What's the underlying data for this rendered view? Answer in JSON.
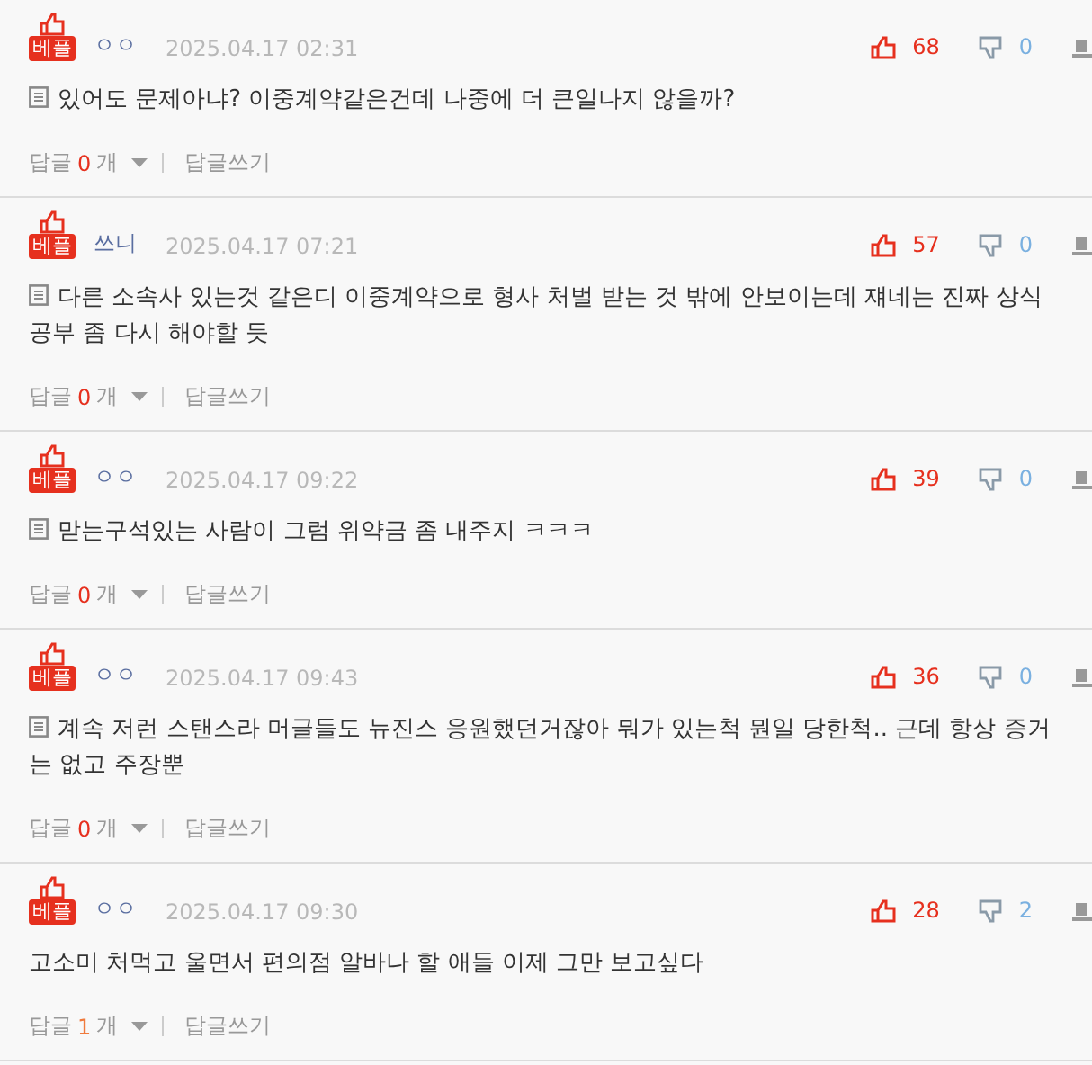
{
  "comments": [
    {
      "badge": "베플",
      "author": "ㅇㅇ",
      "date": "2025.04.17 02:31",
      "likes": "68",
      "dislikes": "0",
      "kind": "memo",
      "text": "있어도 문제아냐? 이중계약같은건데 나중에 더 큰일나지 않을까?",
      "reply_label": "답글",
      "reply_count": "0",
      "reply_unit": "개",
      "has_replies": false,
      "write_reply": "답글쓰기"
    },
    {
      "badge": "베플",
      "author": "쓰니",
      "date": "2025.04.17 07:21",
      "likes": "57",
      "dislikes": "0",
      "kind": "memo",
      "text": "다른 소속사 있는것 같은디 이중계약으로 형사 처벌 받는 것 밖에 안보이는데 쟤네는 진짜 상식 공부 좀 다시 해야할 듯",
      "reply_label": "답글",
      "reply_count": "0",
      "reply_unit": "개",
      "has_replies": false,
      "write_reply": "답글쓰기"
    },
    {
      "badge": "베플",
      "author": "ㅇㅇ",
      "date": "2025.04.17 09:22",
      "likes": "39",
      "dislikes": "0",
      "kind": "memo",
      "text": "맏는구석있는 사람이 그럼 위약금 좀 내주지 ㅋㅋㅋ",
      "reply_label": "답글",
      "reply_count": "0",
      "reply_unit": "개",
      "has_replies": false,
      "write_reply": "답글쓰기"
    },
    {
      "badge": "베플",
      "author": "ㅇㅇ",
      "date": "2025.04.17 09:43",
      "likes": "36",
      "dislikes": "0",
      "kind": "memo",
      "text": "계속 저런 스탠스라 머글들도 뉴진스 응원했던거잖아 뭐가 있는척 뭔일 당한척.. 근데 항상 증거는 없고 주장뿐",
      "reply_label": "답글",
      "reply_count": "0",
      "reply_unit": "개",
      "has_replies": false,
      "write_reply": "답글쓰기"
    },
    {
      "badge": "베플",
      "author": "ㅇㅇ",
      "date": "2025.04.17 09:30",
      "likes": "28",
      "dislikes": "2",
      "kind": "plain",
      "text": "고소미 처먹고 울면서 편의점 알바나 할 애들 이제 그만 보고싶다",
      "reply_label": "답글",
      "reply_count": "1",
      "reply_unit": "개",
      "has_replies": true,
      "write_reply": "답글쓰기"
    }
  ]
}
